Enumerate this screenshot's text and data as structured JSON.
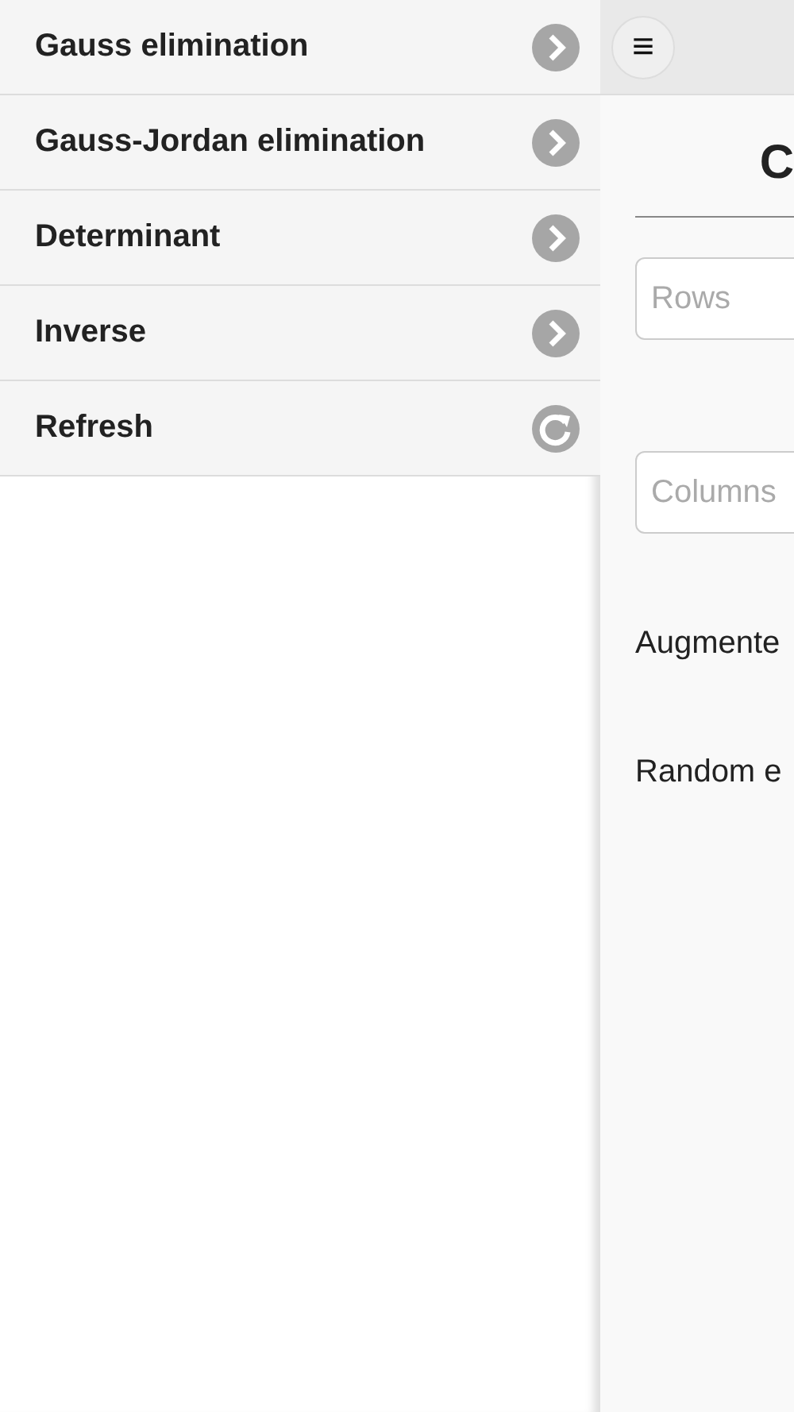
{
  "menu": [
    {
      "label": "Gauss elimination",
      "kind": "arrow"
    },
    {
      "label": "Gauss-Jordan elimination",
      "kind": "arrow"
    },
    {
      "label": "Determinant",
      "kind": "arrow"
    },
    {
      "label": "Inverse",
      "kind": "arrow"
    },
    {
      "label": "Refresh",
      "kind": "refresh"
    }
  ],
  "header": {
    "menu_button": "≡"
  },
  "title": "C",
  "fields": [
    {
      "placeholder": "Rows"
    },
    {
      "placeholder": "Columns"
    }
  ],
  "options": [
    "Augmente",
    "Random e"
  ]
}
